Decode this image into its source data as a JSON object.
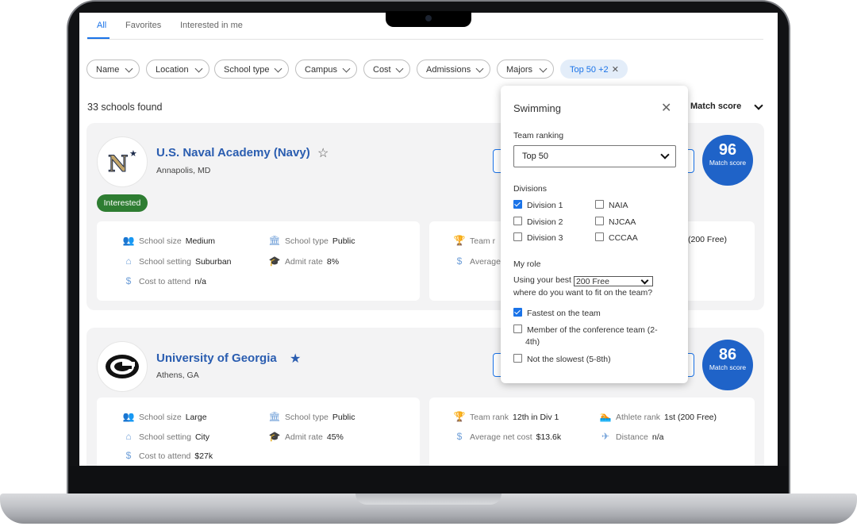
{
  "tabs": [
    {
      "label": "All",
      "active": true
    },
    {
      "label": "Favorites",
      "active": false
    },
    {
      "label": "Interested in me",
      "active": false
    }
  ],
  "filters": [
    {
      "label": "Name"
    },
    {
      "label": "Location"
    },
    {
      "label": "School type"
    },
    {
      "label": "Campus"
    },
    {
      "label": "Cost"
    },
    {
      "label": "Admissions"
    },
    {
      "label": "Majors"
    }
  ],
  "active_filter": {
    "label": "Top 50 +2",
    "remove_icon": "close-icon"
  },
  "results": {
    "count_text": "33 schools found",
    "sort_label": "Match score"
  },
  "schools": [
    {
      "name": "U.S. Naval Academy (Navy)",
      "location": "Annapolis, MD",
      "favorite": false,
      "status_badge": "Interested",
      "match_score": "96",
      "match_label": "Match score",
      "attributes": [
        {
          "label": "School size",
          "value": "Medium",
          "icon": "people-icon"
        },
        {
          "label": "School type",
          "value": "Public",
          "icon": "building-icon"
        },
        {
          "label": "School setting",
          "value": "Suburban",
          "icon": "home-icon"
        },
        {
          "label": "Admit rate",
          "value": "8%",
          "icon": "graduation-cap-icon"
        },
        {
          "label": "Cost to attend",
          "value": "n/a",
          "icon": "dollar-icon"
        }
      ],
      "partial_attributes": [
        {
          "label": "Team r",
          "icon": "trophy-icon"
        },
        {
          "label": "Average",
          "icon": "dollar-icon"
        }
      ],
      "partial_right_text": "(200 Free)"
    },
    {
      "name": "University of Georgia",
      "location": "Athens, GA",
      "favorite": true,
      "match_score": "86",
      "match_label": "Match score",
      "attributes": [
        {
          "label": "School size",
          "value": "Large",
          "icon": "people-icon"
        },
        {
          "label": "School type",
          "value": "Public",
          "icon": "building-icon"
        },
        {
          "label": "School setting",
          "value": "City",
          "icon": "home-icon"
        },
        {
          "label": "Admit rate",
          "value": "45%",
          "icon": "graduation-cap-icon"
        },
        {
          "label": "Cost to attend",
          "value": "$27k",
          "icon": "dollar-icon"
        }
      ],
      "athletics": [
        {
          "label": "Team rank",
          "value": "12th in Div 1",
          "icon": "trophy-icon"
        },
        {
          "label": "Athlete rank",
          "value": "1st (200 Free)",
          "icon": "swimmer-icon"
        },
        {
          "label": "Average net cost",
          "value": "$13.6k",
          "icon": "dollar-icon"
        },
        {
          "label": "Distance",
          "value": "n/a",
          "icon": "plane-icon"
        }
      ]
    }
  ],
  "popover": {
    "title": "Swimming",
    "team_ranking_label": "Team ranking",
    "team_ranking_value": "Top 50",
    "divisions_label": "Divisions",
    "divisions": [
      {
        "label": "Division 1",
        "checked": true
      },
      {
        "label": "Division 2",
        "checked": false
      },
      {
        "label": "Division 3",
        "checked": false
      },
      {
        "label": "NAIA",
        "checked": false
      },
      {
        "label": "NJCAA",
        "checked": false
      },
      {
        "label": "CCCAA",
        "checked": false
      }
    ],
    "role_label": "My role",
    "role_prompt_prefix": "Using your best",
    "role_event": "200 Free",
    "role_prompt_suffix": "where do you want to fit on the team?",
    "role_options": [
      {
        "label": "Fastest on the team",
        "checked": true
      },
      {
        "label_line1": "Member of the conference team (2-",
        "label_line2": "4th)",
        "checked": false
      },
      {
        "label": "Not the slowest (5-8th)",
        "checked": false
      }
    ]
  },
  "colors": {
    "accent": "#1a73e8",
    "name_link": "#2a5db0",
    "match_badge": "#1f63c8",
    "interested_badge": "#2e7d32"
  }
}
